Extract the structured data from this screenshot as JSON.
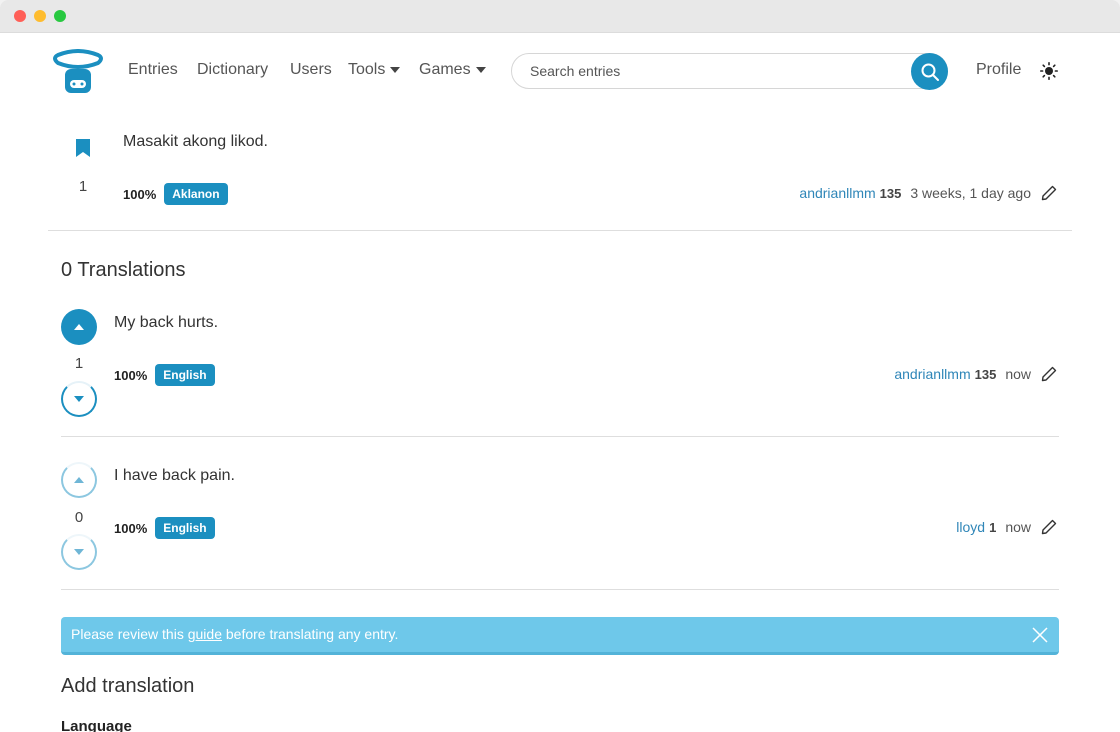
{
  "nav": {
    "links": [
      "Entries",
      "Dictionary",
      "Users"
    ],
    "tools": "Tools",
    "games": "Games",
    "profile": "Profile"
  },
  "search": {
    "placeholder": "Search entries"
  },
  "entry": {
    "text": "Masakit akong likod.",
    "count": "1",
    "percent": "100%",
    "language": "Aklanon",
    "author": "andrianllmm",
    "score": "135",
    "time": "3 weeks, 1 day ago"
  },
  "translations_title": "0 Translations",
  "translations": [
    {
      "text": "My back hurts.",
      "votes": "1",
      "percent": "100%",
      "language": "English",
      "author": "andrianllmm",
      "score": "135",
      "time": "now"
    },
    {
      "text": "I have back pain.",
      "votes": "0",
      "percent": "100%",
      "language": "English",
      "author": "lloyd",
      "score": "1",
      "time": "now"
    }
  ],
  "alert": {
    "before": "Please review this ",
    "link": "guide",
    "after": " before translating any entry."
  },
  "add_translation": "Add translation",
  "language_label": "Language",
  "colors": {
    "accent": "#1b8fc0",
    "alert": "#6ec8ea",
    "link": "#2f86b8"
  }
}
